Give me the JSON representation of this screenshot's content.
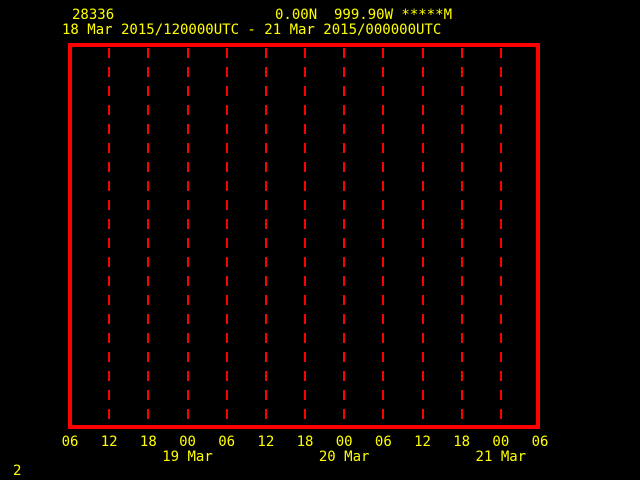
{
  "colors": {
    "background": "#000000",
    "text": "#ffff00",
    "frame": "#ff0000"
  },
  "header": {
    "station_id": "28336",
    "location": "0.00N  999.90W *****M",
    "time_range": "18 Mar 2015/120000UTC - 21 Mar 2015/000000UTC"
  },
  "footer": {
    "page_number": "2"
  },
  "chart_data": {
    "type": "line",
    "title": "",
    "xlabel": "",
    "ylabel": "",
    "x_axis": {
      "unit": "hour UTC",
      "tick_labels": [
        "06",
        "12",
        "18",
        "00",
        "06",
        "12",
        "18",
        "00",
        "06",
        "12",
        "18",
        "00",
        "06"
      ],
      "date_labels": [
        {
          "label": "19 Mar",
          "tick_index": 3
        },
        {
          "label": "20 Mar",
          "tick_index": 7
        },
        {
          "label": "21 Mar",
          "tick_index": 11
        }
      ]
    },
    "series": [],
    "layout": {
      "grid": "vertical dashed gridlines at interior ticks only",
      "frame_color": "#ff0000",
      "legend": "none"
    }
  }
}
